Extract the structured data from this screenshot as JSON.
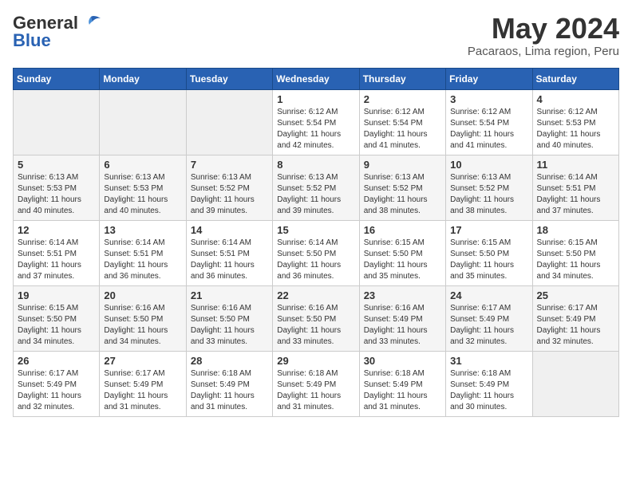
{
  "logo": {
    "general": "General",
    "blue": "Blue"
  },
  "header": {
    "month": "May 2024",
    "location": "Pacaraos, Lima region, Peru"
  },
  "days_of_week": [
    "Sunday",
    "Monday",
    "Tuesday",
    "Wednesday",
    "Thursday",
    "Friday",
    "Saturday"
  ],
  "weeks": [
    [
      {
        "num": "",
        "info": ""
      },
      {
        "num": "",
        "info": ""
      },
      {
        "num": "",
        "info": ""
      },
      {
        "num": "1",
        "info": "Sunrise: 6:12 AM\nSunset: 5:54 PM\nDaylight: 11 hours\nand 42 minutes."
      },
      {
        "num": "2",
        "info": "Sunrise: 6:12 AM\nSunset: 5:54 PM\nDaylight: 11 hours\nand 41 minutes."
      },
      {
        "num": "3",
        "info": "Sunrise: 6:12 AM\nSunset: 5:54 PM\nDaylight: 11 hours\nand 41 minutes."
      },
      {
        "num": "4",
        "info": "Sunrise: 6:12 AM\nSunset: 5:53 PM\nDaylight: 11 hours\nand 40 minutes."
      }
    ],
    [
      {
        "num": "5",
        "info": "Sunrise: 6:13 AM\nSunset: 5:53 PM\nDaylight: 11 hours\nand 40 minutes."
      },
      {
        "num": "6",
        "info": "Sunrise: 6:13 AM\nSunset: 5:53 PM\nDaylight: 11 hours\nand 40 minutes."
      },
      {
        "num": "7",
        "info": "Sunrise: 6:13 AM\nSunset: 5:52 PM\nDaylight: 11 hours\nand 39 minutes."
      },
      {
        "num": "8",
        "info": "Sunrise: 6:13 AM\nSunset: 5:52 PM\nDaylight: 11 hours\nand 39 minutes."
      },
      {
        "num": "9",
        "info": "Sunrise: 6:13 AM\nSunset: 5:52 PM\nDaylight: 11 hours\nand 38 minutes."
      },
      {
        "num": "10",
        "info": "Sunrise: 6:13 AM\nSunset: 5:52 PM\nDaylight: 11 hours\nand 38 minutes."
      },
      {
        "num": "11",
        "info": "Sunrise: 6:14 AM\nSunset: 5:51 PM\nDaylight: 11 hours\nand 37 minutes."
      }
    ],
    [
      {
        "num": "12",
        "info": "Sunrise: 6:14 AM\nSunset: 5:51 PM\nDaylight: 11 hours\nand 37 minutes."
      },
      {
        "num": "13",
        "info": "Sunrise: 6:14 AM\nSunset: 5:51 PM\nDaylight: 11 hours\nand 36 minutes."
      },
      {
        "num": "14",
        "info": "Sunrise: 6:14 AM\nSunset: 5:51 PM\nDaylight: 11 hours\nand 36 minutes."
      },
      {
        "num": "15",
        "info": "Sunrise: 6:14 AM\nSunset: 5:50 PM\nDaylight: 11 hours\nand 36 minutes."
      },
      {
        "num": "16",
        "info": "Sunrise: 6:15 AM\nSunset: 5:50 PM\nDaylight: 11 hours\nand 35 minutes."
      },
      {
        "num": "17",
        "info": "Sunrise: 6:15 AM\nSunset: 5:50 PM\nDaylight: 11 hours\nand 35 minutes."
      },
      {
        "num": "18",
        "info": "Sunrise: 6:15 AM\nSunset: 5:50 PM\nDaylight: 11 hours\nand 34 minutes."
      }
    ],
    [
      {
        "num": "19",
        "info": "Sunrise: 6:15 AM\nSunset: 5:50 PM\nDaylight: 11 hours\nand 34 minutes."
      },
      {
        "num": "20",
        "info": "Sunrise: 6:16 AM\nSunset: 5:50 PM\nDaylight: 11 hours\nand 34 minutes."
      },
      {
        "num": "21",
        "info": "Sunrise: 6:16 AM\nSunset: 5:50 PM\nDaylight: 11 hours\nand 33 minutes."
      },
      {
        "num": "22",
        "info": "Sunrise: 6:16 AM\nSunset: 5:50 PM\nDaylight: 11 hours\nand 33 minutes."
      },
      {
        "num": "23",
        "info": "Sunrise: 6:16 AM\nSunset: 5:49 PM\nDaylight: 11 hours\nand 33 minutes."
      },
      {
        "num": "24",
        "info": "Sunrise: 6:17 AM\nSunset: 5:49 PM\nDaylight: 11 hours\nand 32 minutes."
      },
      {
        "num": "25",
        "info": "Sunrise: 6:17 AM\nSunset: 5:49 PM\nDaylight: 11 hours\nand 32 minutes."
      }
    ],
    [
      {
        "num": "26",
        "info": "Sunrise: 6:17 AM\nSunset: 5:49 PM\nDaylight: 11 hours\nand 32 minutes."
      },
      {
        "num": "27",
        "info": "Sunrise: 6:17 AM\nSunset: 5:49 PM\nDaylight: 11 hours\nand 31 minutes."
      },
      {
        "num": "28",
        "info": "Sunrise: 6:18 AM\nSunset: 5:49 PM\nDaylight: 11 hours\nand 31 minutes."
      },
      {
        "num": "29",
        "info": "Sunrise: 6:18 AM\nSunset: 5:49 PM\nDaylight: 11 hours\nand 31 minutes."
      },
      {
        "num": "30",
        "info": "Sunrise: 6:18 AM\nSunset: 5:49 PM\nDaylight: 11 hours\nand 31 minutes."
      },
      {
        "num": "31",
        "info": "Sunrise: 6:18 AM\nSunset: 5:49 PM\nDaylight: 11 hours\nand 30 minutes."
      },
      {
        "num": "",
        "info": ""
      }
    ]
  ]
}
